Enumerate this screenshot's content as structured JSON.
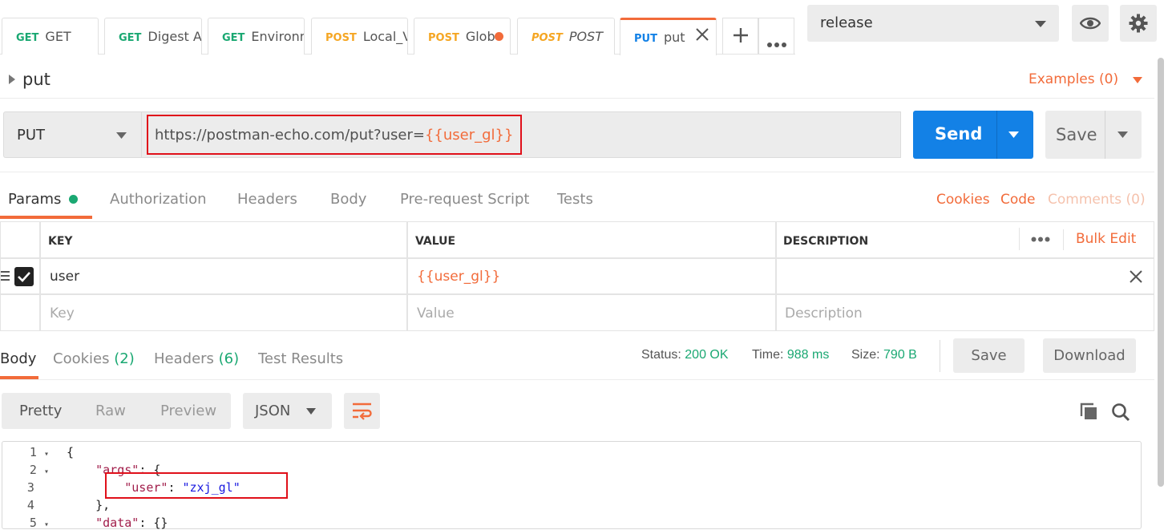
{
  "tabs": [
    {
      "method": "GET",
      "name": "GET",
      "color": "#1aa872"
    },
    {
      "method": "GET",
      "name": "Digest Au",
      "color": "#1aa872"
    },
    {
      "method": "GET",
      "name": "Environm",
      "color": "#1aa872"
    },
    {
      "method": "POST",
      "name": "Local_V",
      "color": "#f5a623"
    },
    {
      "method": "POST",
      "name": "Glob",
      "color": "#f5a623"
    },
    {
      "method": "POST",
      "name": "POST",
      "color": "#f5a623"
    },
    {
      "method": "PUT",
      "name": "put",
      "color": "#1381e6"
    }
  ],
  "environment": {
    "selected": "release"
  },
  "request": {
    "title": "put",
    "examples_label": "Examples (0)",
    "method": "PUT",
    "url_base": "https://postman-echo.com/put?user=",
    "url_var": "{{user_gl}}",
    "send_label": "Send",
    "save_label": "Save"
  },
  "request_tabs": {
    "params": "Params",
    "authorization": "Authorization",
    "headers": "Headers",
    "body": "Body",
    "prerequest": "Pre-request Script",
    "tests": "Tests",
    "cookies": "Cookies",
    "code": "Code",
    "comments": "Comments (0)"
  },
  "params_table": {
    "headers": {
      "key": "KEY",
      "value": "VALUE",
      "description": "DESCRIPTION",
      "bulk_edit": "Bulk Edit"
    },
    "rows": [
      {
        "key": "user",
        "value": "{{user_gl}}",
        "description": ""
      }
    ],
    "placeholder": {
      "key": "Key",
      "value": "Value",
      "description": "Description"
    }
  },
  "response_tabs": {
    "body": "Body",
    "cookies": "Cookies",
    "cookies_count": "(2)",
    "headers": "Headers",
    "headers_count": "(6)",
    "test_results": "Test Results"
  },
  "response_status": {
    "status_label": "Status:",
    "status": "200 OK",
    "time_label": "Time:",
    "time": "988 ms",
    "size_label": "Size:",
    "size": "790 B",
    "save_label": "Save",
    "download_label": "Download"
  },
  "body_view": {
    "pretty": "Pretty",
    "raw": "Raw",
    "preview": "Preview",
    "format": "JSON"
  },
  "code_lines": [
    {
      "n": "1",
      "text": "{"
    },
    {
      "n": "2",
      "key": "\"args\"",
      "rest": ": {"
    },
    {
      "n": "3",
      "key": "\"user\"",
      "rest": ": ",
      "str": "\"zxj_gl\""
    },
    {
      "n": "4",
      "text": "},"
    },
    {
      "n": "5",
      "key": "\"data\"",
      "rest": ": {}"
    }
  ],
  "colors": {
    "accent": "#f26b3a",
    "send": "#1381e6",
    "green": "#1aa872",
    "highlight_box": "#e0101a"
  }
}
